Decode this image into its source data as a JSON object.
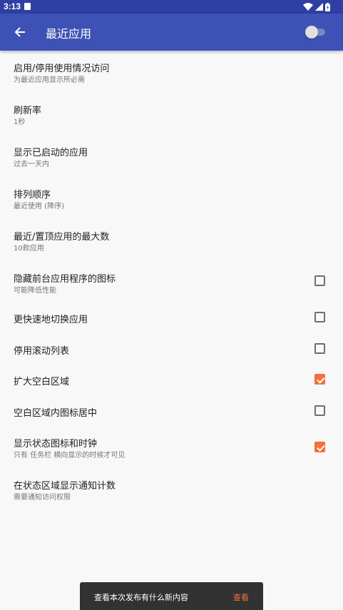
{
  "status_bar": {
    "time": "3:13"
  },
  "app_bar": {
    "title": "最近应用",
    "back_icon": "arrow-back-icon",
    "master_switch_on": false
  },
  "preferences": [
    {
      "title": "启用/停用使用情况访问",
      "summary": "为最近应用显示所必需"
    },
    {
      "title": "刷新率",
      "summary": "1秒"
    },
    {
      "title": "显示已启动的应用",
      "summary": "过去一天内"
    },
    {
      "title": "排列顺序",
      "summary": "最近使用 (降序)"
    },
    {
      "title": "最近/置顶应用的最大数",
      "summary": "10款应用"
    },
    {
      "title": "隐藏前台应用程序的图标",
      "summary": "可能降低性能",
      "checked": false
    },
    {
      "title": "更快速地切换应用",
      "checked": false
    },
    {
      "title": "停用滚动列表",
      "checked": false
    },
    {
      "title": "扩大空白区域",
      "checked": true
    },
    {
      "title": "空白区域内图标居中",
      "checked": false
    },
    {
      "title": "显示状态图标和时钟",
      "summary": "只有 任务栏 横向显示的时候才可见",
      "checked": true
    },
    {
      "title": "在状态区域显示通知计数",
      "summary": "需要通知访问权限"
    }
  ],
  "snackbar": {
    "message": "查看本次发布有什么新内容",
    "action": "查看"
  },
  "colors": {
    "status_bar": "#2f3fa3",
    "app_bar": "#3d52b4",
    "accent": "#f4713b",
    "background": "#f8f8f8"
  }
}
